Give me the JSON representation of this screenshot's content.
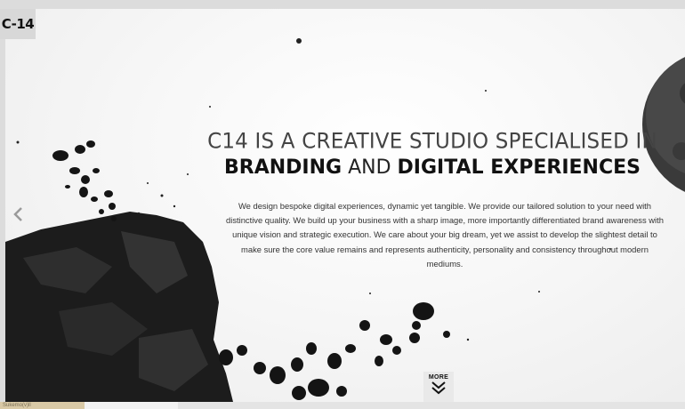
{
  "brand": {
    "logo_text": "C-14"
  },
  "hero": {
    "headline_line1": "C14 IS A CREATIVE STUDIO SPECIALISED IN",
    "headline_strong1": "BRANDING",
    "headline_and": "AND",
    "headline_strong2": "DIGITAL EXPERIENCES",
    "description": "We design bespoke digital experiences, dynamic yet tangible. We provide our tailored solution to your need with distinctive quality. We build up your business with a sharp image, more importantly differentiated brand awareness with unique vision and strategic execution. We care about your big dream, yet we assist to develop the slightest detail to make sure the core value remains and represents authenticity, personality and consistency throughout modern mediums."
  },
  "controls": {
    "prev_icon": "chevron-left-icon",
    "more_label": "MORE",
    "more_icon": "double-chevron-down-icon"
  },
  "footer": {
    "tag_text": "Sukemo(v)ll"
  },
  "colors": {
    "background": "#f6f6f6",
    "text_dark": "#111111",
    "rock": "#1a1a1a"
  }
}
